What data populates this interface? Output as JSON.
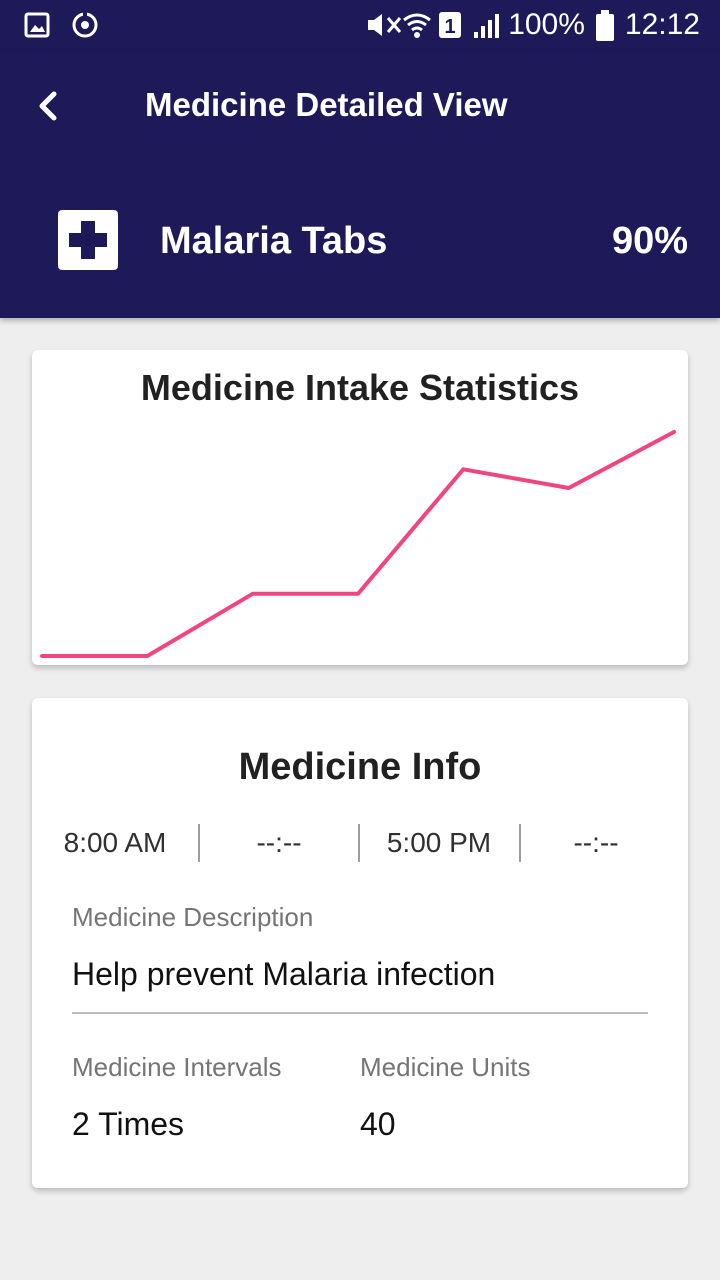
{
  "status_bar": {
    "battery_percent": "100%",
    "time": "12:12",
    "sim_slot": "1",
    "icons": [
      "gallery-icon",
      "sync-icon",
      "mute-icon",
      "wifi-icon",
      "sim-icon",
      "signal-icon",
      "battery-icon"
    ]
  },
  "header": {
    "title": "Medicine Detailed View",
    "back_icon": "chevron-left-icon",
    "background_color": "#1e1a5a"
  },
  "medicine": {
    "icon": "medical-cross-icon",
    "name": "Malaria Tabs",
    "percent": "90%"
  },
  "chart": {
    "title": "Medicine Intake Statistics",
    "line_color": "#f0457f"
  },
  "chart_data": {
    "type": "line",
    "title": "Medicine Intake Statistics",
    "xlabel": "",
    "ylabel": "",
    "grid": false,
    "legend": "none",
    "x": [
      0,
      1,
      2,
      3,
      4,
      5,
      6
    ],
    "series": [
      {
        "values": [
          0,
          0,
          1,
          1,
          3,
          2.7,
          3.6
        ]
      }
    ],
    "ylim": [
      0,
      3.6
    ]
  },
  "info": {
    "title": "Medicine Info",
    "times": [
      "8:00 AM",
      "--:--",
      "5:00 PM",
      "--:--"
    ],
    "description_label": "Medicine Description",
    "description_value": "Help prevent Malaria infection",
    "intervals_label": "Medicine Intervals",
    "intervals_value": "2 Times",
    "units_label": "Medicine Units",
    "units_value": "40"
  }
}
